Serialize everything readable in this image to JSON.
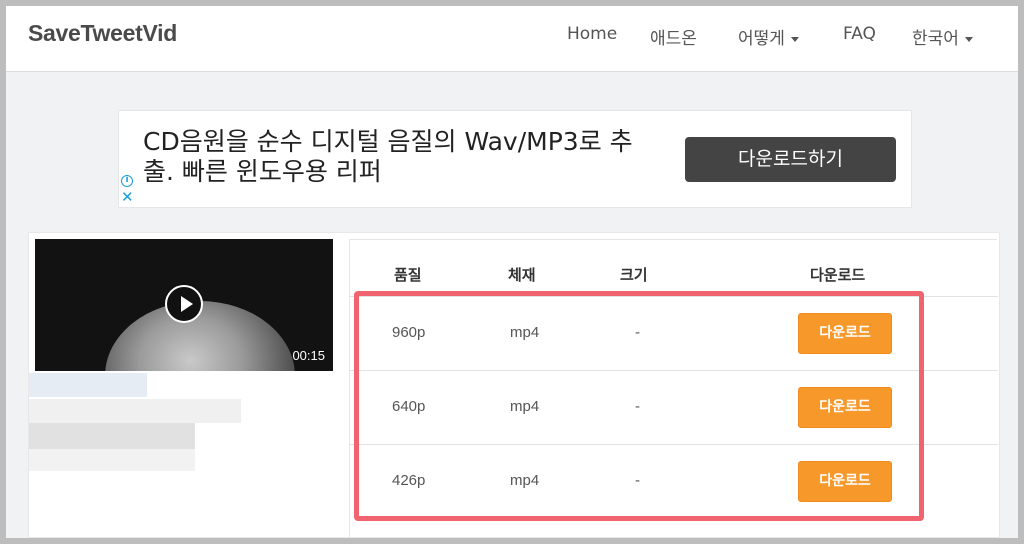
{
  "navbar": {
    "brand": "SaveTweetVid",
    "items": [
      {
        "label": "Home"
      },
      {
        "label": "애드온"
      },
      {
        "label": "어떻게"
      },
      {
        "label": "FAQ"
      },
      {
        "label": "한국어"
      }
    ]
  },
  "ad": {
    "text": "CD음원을 순수 디지털 음질의 Wav/MP3로 추출. 빠른 윈도우용 리퍼",
    "button": "다운로드하기",
    "info_icon": "i",
    "close_icon": "✕"
  },
  "video": {
    "duration": "00:15"
  },
  "table": {
    "headers": {
      "quality": "품질",
      "format": "체재",
      "size": "크기",
      "download": "다운로드"
    },
    "rows": [
      {
        "quality": "960p",
        "format": "mp4",
        "size": "-",
        "button": "다운로드"
      },
      {
        "quality": "640p",
        "format": "mp4",
        "size": "-",
        "button": "다운로드"
      },
      {
        "quality": "426p",
        "format": "mp4",
        "size": "-",
        "button": "다운로드"
      }
    ]
  },
  "colors": {
    "accent_button": "#f7982b",
    "highlight_border": "#f06470",
    "ad_button": "#444444"
  }
}
